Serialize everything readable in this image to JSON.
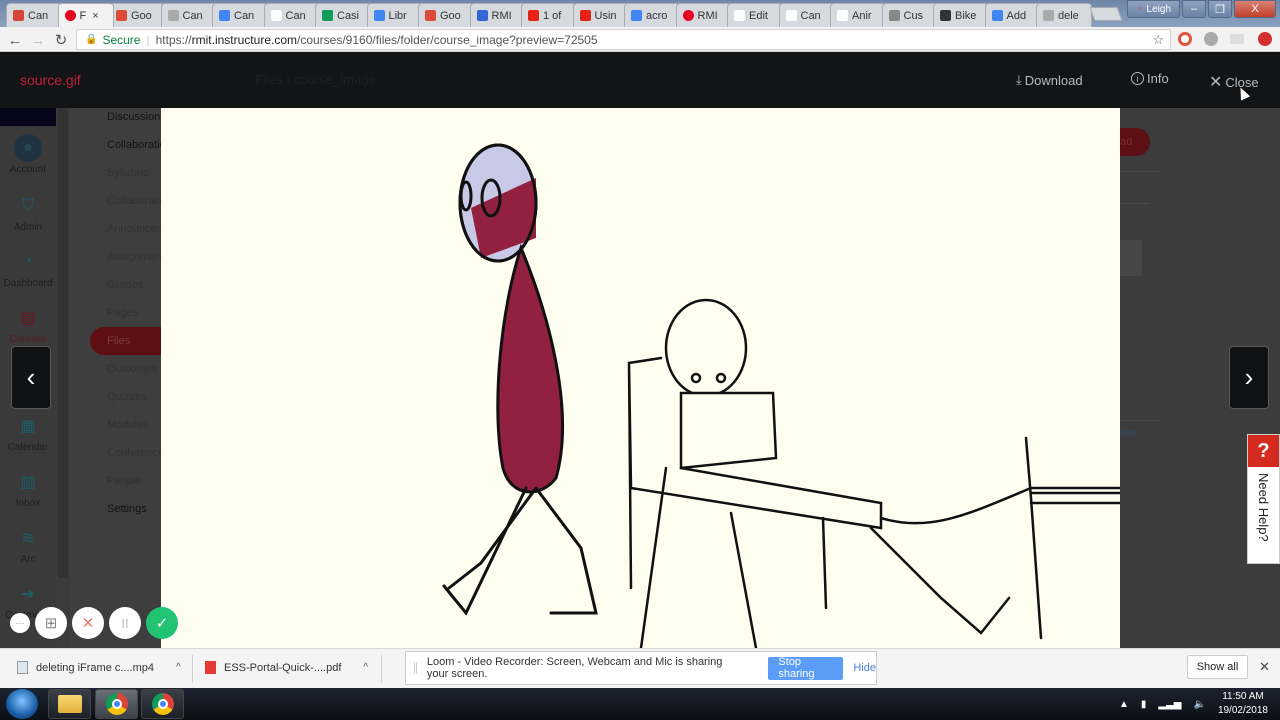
{
  "browser": {
    "tabs": [
      {
        "label": "Can",
        "icon": "gmail-icon",
        "color": "#d44638"
      },
      {
        "label": "F",
        "icon": "rmit-icon",
        "color": "#e6001e",
        "active": true
      },
      {
        "label": "Goo",
        "icon": "google-plus-icon",
        "color": "#dd4b39"
      },
      {
        "label": "Can",
        "icon": "loading-icon",
        "color": "#aaaaaa"
      },
      {
        "label": "Can",
        "icon": "docs-icon",
        "color": "#4285f4"
      },
      {
        "label": "Can",
        "icon": "page-icon",
        "color": "#ffffff"
      },
      {
        "label": "Casi",
        "icon": "sheets-icon",
        "color": "#0f9d58"
      },
      {
        "label": "Libr",
        "icon": "docs-icon",
        "color": "#4285f4"
      },
      {
        "label": "Goo",
        "icon": "google-plus-icon",
        "color": "#dd4b39"
      },
      {
        "label": "RMI",
        "icon": "calendar-icon",
        "color": "#3367d6"
      },
      {
        "label": "1 of",
        "icon": "youtube-icon",
        "color": "#e62117"
      },
      {
        "label": "Usin",
        "icon": "youtube-icon",
        "color": "#e62117"
      },
      {
        "label": "acro",
        "icon": "google-icon",
        "color": "#4285f4"
      },
      {
        "label": "RMI",
        "icon": "rmit-icon",
        "color": "#e6001e"
      },
      {
        "label": "Edit",
        "icon": "page-icon",
        "color": "#ffffff"
      },
      {
        "label": "Can",
        "icon": "page-icon",
        "color": "#ffffff"
      },
      {
        "label": "Anir",
        "icon": "wikipedia-icon",
        "color": "#ffffff"
      },
      {
        "label": "Cus",
        "icon": "custom-icon",
        "color": "#888888"
      },
      {
        "label": "Bike",
        "icon": "bike-icon",
        "color": "#333333"
      },
      {
        "label": "Add",
        "icon": "google-icon",
        "color": "#4285f4"
      },
      {
        "label": "dele",
        "icon": "loading-icon",
        "color": "#aaaaaa"
      }
    ],
    "tab_close": "×",
    "profile_name": "Leigh",
    "window_controls": {
      "minimize": "–",
      "maximize": "❐",
      "close": "X"
    },
    "address": {
      "secure_label": "Secure",
      "url_prefix": "https://",
      "url_host": "rmit.instructure.com",
      "url_path": "/courses/9160/files/folder/course_image?preview=72505"
    }
  },
  "viewer": {
    "filename": "source.gif",
    "faint_title": "Files  ›  course_image",
    "download_label": "Download",
    "info_label": "Info",
    "close_label": "Close",
    "prev": "‹",
    "next": "›"
  },
  "global_nav": [
    {
      "label": "Account",
      "icon": "avatar-icon"
    },
    {
      "label": "Admin",
      "icon": "shield-key-icon"
    },
    {
      "label": "Dashboard",
      "icon": "dashboard-icon"
    },
    {
      "label": "Courses",
      "icon": "book-icon"
    },
    {
      "label": "Calendar",
      "icon": "calendar-icon"
    },
    {
      "label": "Inbox",
      "icon": "inbox-icon"
    },
    {
      "label": "Arc",
      "icon": "arc-icon"
    },
    {
      "label": "Commons",
      "icon": "commons-icon"
    }
  ],
  "course_nav": [
    {
      "label": "Discussions",
      "dark": true
    },
    {
      "label": "Collaborations",
      "dark": true
    },
    {
      "label": "Syllabus"
    },
    {
      "label": "Collaborations"
    },
    {
      "label": "Announcements"
    },
    {
      "label": "Assignments"
    },
    {
      "label": "Grades"
    },
    {
      "label": "Pages"
    },
    {
      "label": "Files",
      "active": true
    },
    {
      "label": "Outcomes"
    },
    {
      "label": "Quizzes"
    },
    {
      "label": "Modules"
    },
    {
      "label": "Conferences"
    },
    {
      "label": "People"
    },
    {
      "label": "Settings",
      "dark": true
    }
  ],
  "background_right": {
    "upload_label": "oad",
    "files_link": "iles"
  },
  "need_help": {
    "q": "?",
    "label": "Need Help?"
  },
  "loom_controls": {
    "more": "···",
    "cam": "⊞",
    "cancel": "✕",
    "pause": "II",
    "done": "✓"
  },
  "downloads": [
    {
      "name": "deleting iFrame c....mp4",
      "icon": "video-file-icon"
    },
    {
      "name": "ESS-Portal-Quick-....pdf",
      "icon": "pdf-file-icon"
    }
  ],
  "share_notice": {
    "text": "Loom - Video Recorder: Screen, Webcam and Mic is sharing your screen.",
    "stop_label": "Stop sharing",
    "hide_label": "Hide"
  },
  "show_all_label": "Show all",
  "taskbar": {
    "time": "11:50 AM",
    "date": "19/02/2018"
  }
}
